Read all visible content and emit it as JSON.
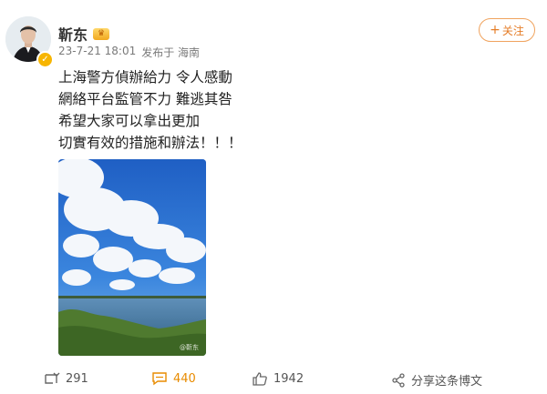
{
  "post": {
    "author": "靳东",
    "vip_icon": "vip-crown-icon",
    "timestamp": "23-7-21 18:01",
    "location": "发布于 海南",
    "follow_label": "关注",
    "lines": [
      "上海警方偵辦給力 令人感動",
      "網絡平台監管不力 難逃其咎",
      "希望大家可以拿出更加",
      "切實有效的措施和辦法！！！"
    ],
    "image_watermark": "@靳东"
  },
  "actions": {
    "repost_count": "291",
    "comment_count": "440",
    "like_count": "1942",
    "share_label": "分享这条博文"
  },
  "colors": {
    "accent": "#e88b00",
    "follow_border": "#f0a35e",
    "text": "#222222",
    "meta": "#7a7a7a"
  }
}
